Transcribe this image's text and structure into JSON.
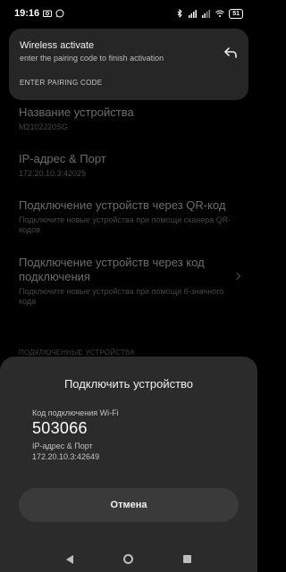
{
  "status_bar": {
    "time": "19:16",
    "battery": "51"
  },
  "background": {
    "items": [
      {
        "title": "Название устройства",
        "subtitle": "M2102J20SG"
      },
      {
        "title": "IP-адрес & Порт",
        "subtitle": "172.20.10.3:42025"
      },
      {
        "title": "Подключение устройств через QR-код",
        "subtitle": "Подключите новые устройства при помощи сканера QR-кодов"
      },
      {
        "title": "Подключение устройств через код подключения",
        "subtitle": "Подключите новые устройства при помощи 6-значного кода"
      }
    ],
    "section_header": "ПОДКЛЮЧЕННЫЕ УСТРОЙСТВА"
  },
  "notification": {
    "title": "Wireless activate",
    "subtitle": "enter the pairing code to finish activation",
    "action": "ENTER PAIRING CODE"
  },
  "dialog": {
    "title": "Подключить устройство",
    "code_label": "Код подключения Wi-Fi",
    "code_value": "503066",
    "ip_label": "IP-адрес & Порт",
    "ip_value": "172.20.10.3:42649",
    "cancel_label": "Отмена"
  }
}
